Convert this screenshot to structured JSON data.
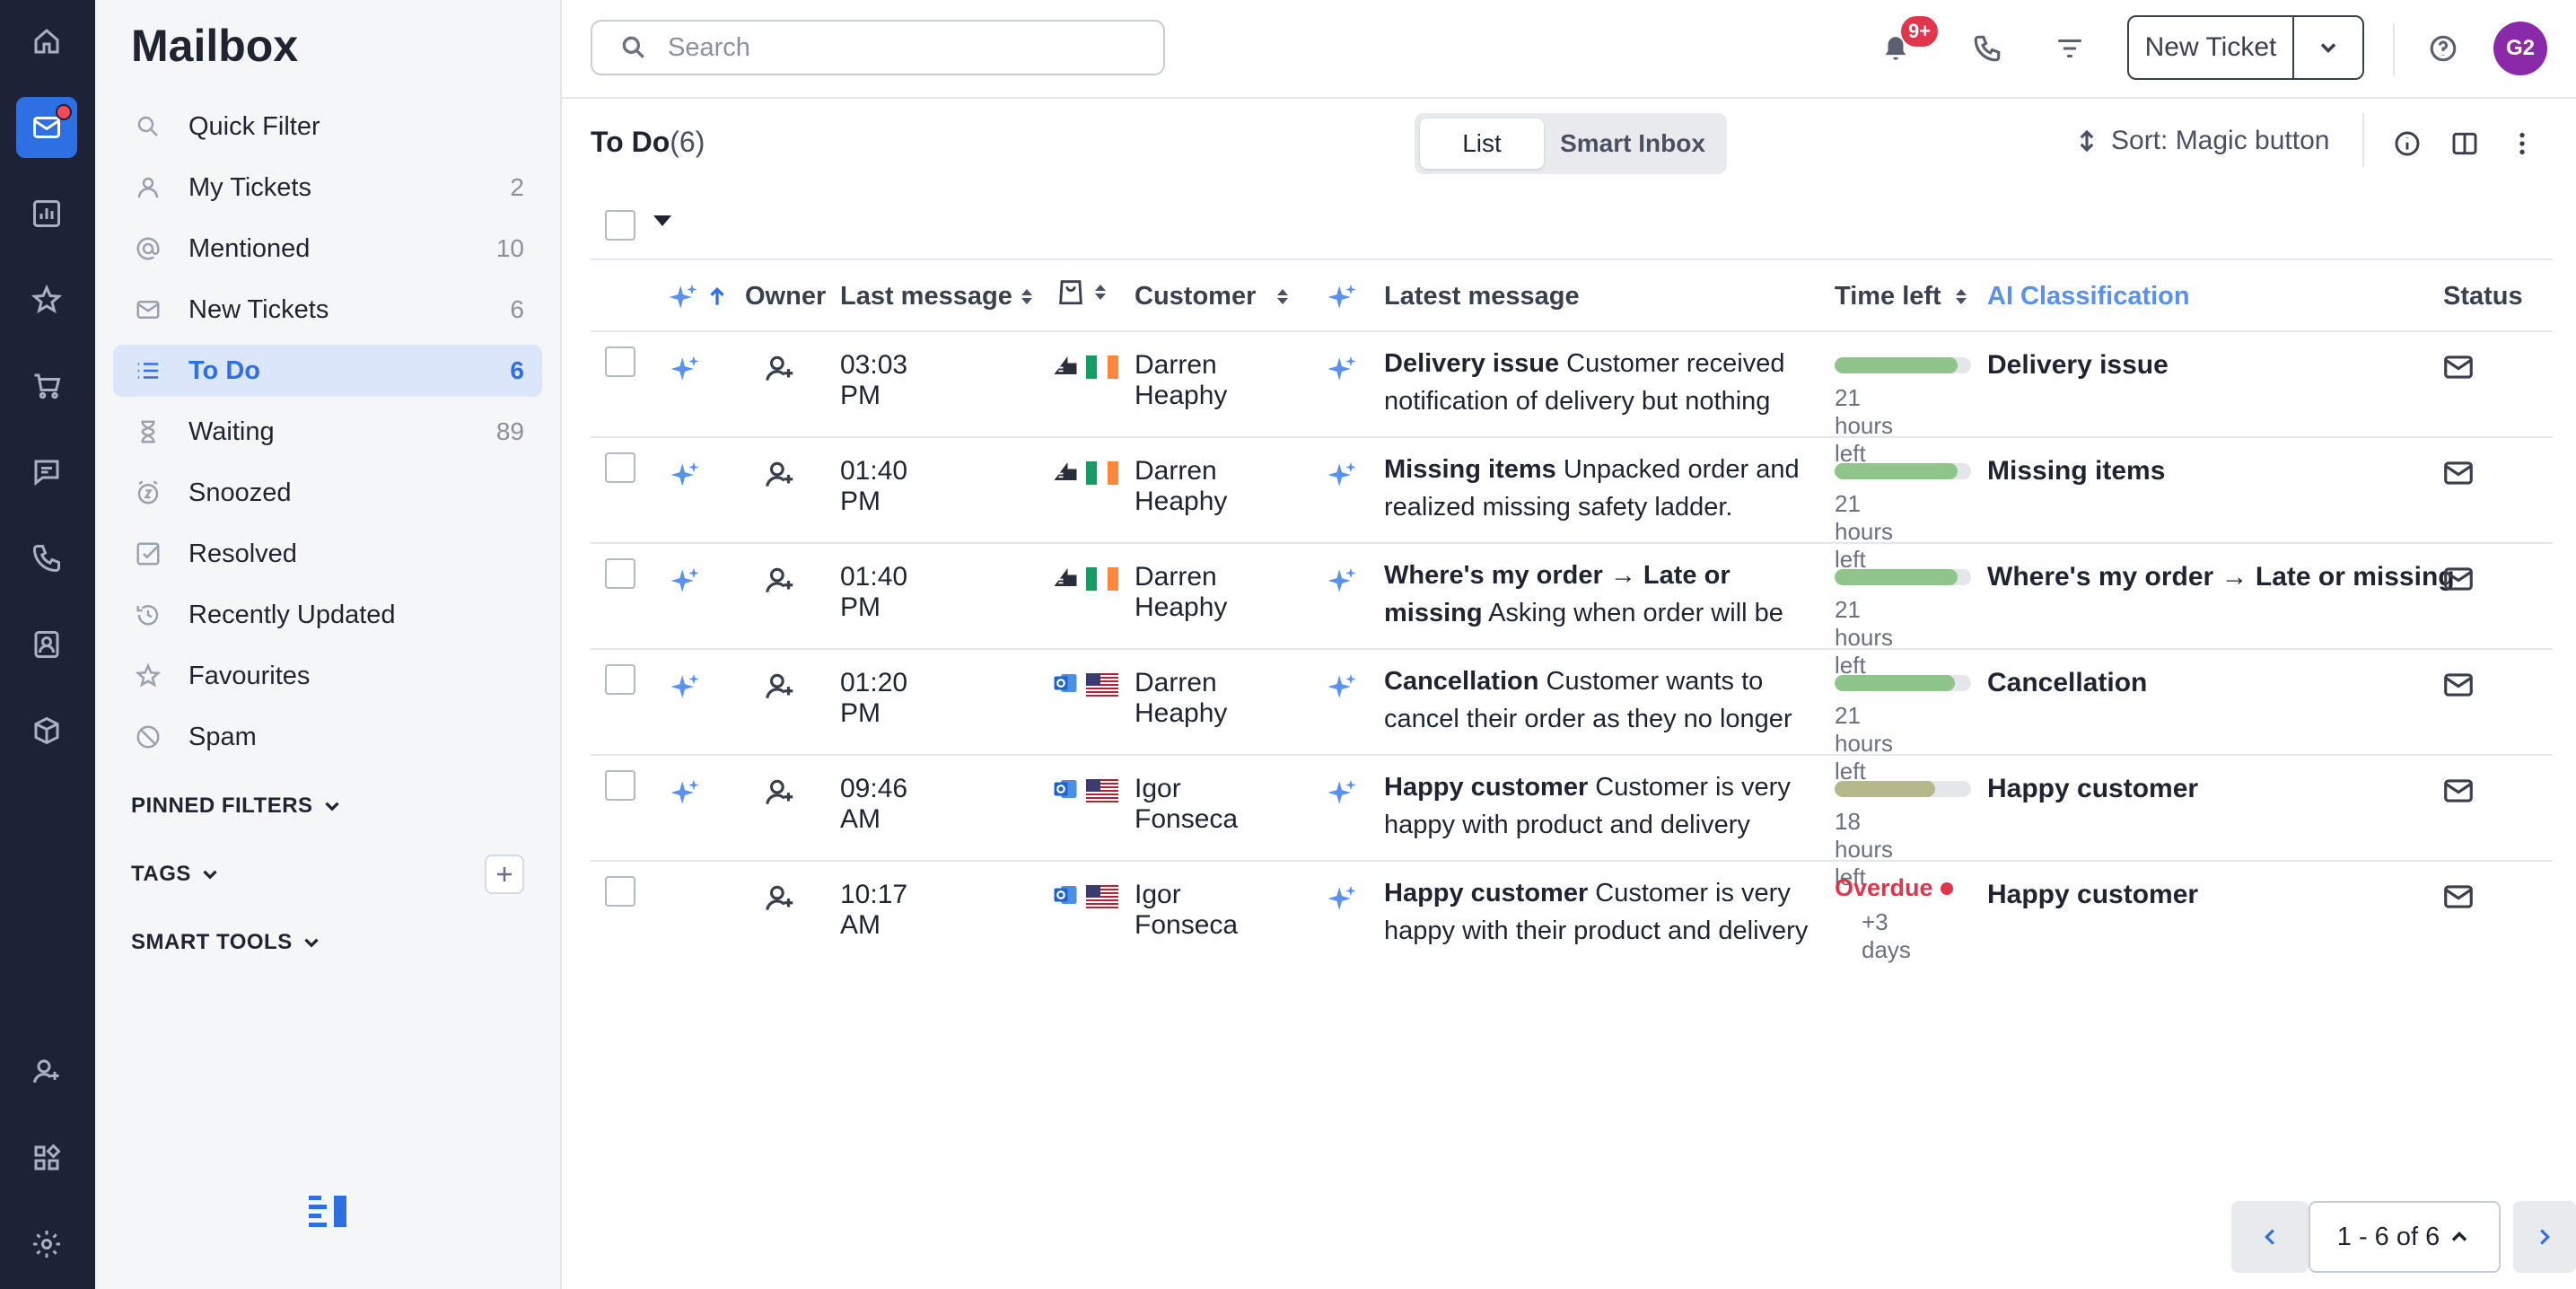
{
  "app": {
    "title": "Mailbox"
  },
  "rail": {
    "items": [
      {
        "name": "home-icon"
      },
      {
        "name": "mail-icon",
        "active": true,
        "has_dot": true
      },
      {
        "name": "reports-icon"
      },
      {
        "name": "star-icon"
      },
      {
        "name": "cart-icon"
      },
      {
        "name": "chat-icon"
      },
      {
        "name": "phone-icon"
      },
      {
        "name": "contacts-icon"
      },
      {
        "name": "knowledge-icon"
      },
      {
        "name": "add-user-icon"
      },
      {
        "name": "apps-icon"
      },
      {
        "name": "settings-icon"
      }
    ]
  },
  "sidebar": {
    "items": [
      {
        "label": "Quick Filter",
        "count": "",
        "icon": "search-icon"
      },
      {
        "label": "My Tickets",
        "count": "2",
        "icon": "person-icon"
      },
      {
        "label": "Mentioned",
        "count": "10",
        "icon": "at-icon"
      },
      {
        "label": "New Tickets",
        "count": "6",
        "icon": "envelope-icon"
      },
      {
        "label": "To Do",
        "count": "6",
        "icon": "list-icon",
        "active": true
      },
      {
        "label": "Waiting",
        "count": "89",
        "icon": "hourglass-icon"
      },
      {
        "label": "Snoozed",
        "count": "",
        "icon": "snooze-icon"
      },
      {
        "label": "Resolved",
        "count": "",
        "icon": "check-icon"
      },
      {
        "label": "Recently Updated",
        "count": "",
        "icon": "history-icon"
      },
      {
        "label": "Favourites",
        "count": "",
        "icon": "star-icon"
      },
      {
        "label": "Spam",
        "count": "",
        "icon": "block-icon"
      }
    ],
    "sections": {
      "pinned": "PINNED FILTERS",
      "tags": "TAGS",
      "smart_tools": "SMART TOOLS"
    }
  },
  "topbar": {
    "search_placeholder": "Search",
    "notification_badge": "9+",
    "new_ticket_label": "New Ticket",
    "avatar_initials": "G2"
  },
  "view": {
    "title": "To Do",
    "count": "(6)",
    "segments": {
      "list": "List",
      "smart_inbox": "Smart Inbox"
    },
    "sort_label": "Sort: Magic button"
  },
  "table": {
    "headers": {
      "owner": "Owner",
      "last_message": "Last message",
      "customer": "Customer",
      "latest_message": "Latest message",
      "time_left": "Time left",
      "ai_classification": "AI Classification",
      "status": "Status"
    },
    "rows": [
      {
        "time": "03:03 PM",
        "channel": "marketplace",
        "flag": "ie",
        "customer": "Darren Heaphy",
        "subject": "Delivery issue",
        "body": "Customer received notification of delivery but nothing",
        "time_left_fraction": 0.9,
        "time_left_color": "#8fc48a",
        "time_left": "21 hours left",
        "overdue": false,
        "ai": "Delivery issue",
        "has_sparkle": true
      },
      {
        "time": "01:40 PM",
        "channel": "marketplace",
        "flag": "ie",
        "customer": "Darren Heaphy",
        "subject": "Missing items",
        "body": "Unpacked order and realized missing safety ladder.",
        "time_left_fraction": 0.9,
        "time_left_color": "#8fc48a",
        "time_left": "21 hours left",
        "overdue": false,
        "ai": "Missing items",
        "has_sparkle": true
      },
      {
        "time": "01:40 PM",
        "channel": "marketplace",
        "flag": "ie",
        "customer": "Darren Heaphy",
        "subject": "Where's my order → Late or missing",
        "body": "Asking when order will be",
        "time_left_fraction": 0.9,
        "time_left_color": "#8fc48a",
        "time_left": "21 hours left",
        "overdue": false,
        "ai": "Where's my order → Late or missing",
        "has_sparkle": true
      },
      {
        "time": "01:20 PM",
        "channel": "outlook",
        "flag": "us",
        "customer": "Darren Heaphy",
        "subject": "Cancellation",
        "body": "Customer wants to cancel their order as they no longer",
        "time_left_fraction": 0.88,
        "time_left_color": "#8fc48a",
        "time_left": "21 hours left",
        "overdue": false,
        "ai": "Cancellation",
        "has_sparkle": true
      },
      {
        "time": "09:46 AM",
        "channel": "outlook",
        "flag": "us",
        "customer": "Igor Fonseca",
        "subject": "Happy customer",
        "body": "Customer is very happy with product and delivery",
        "time_left_fraction": 0.74,
        "time_left_color": "#b5b98a",
        "time_left": "18 hours left",
        "overdue": false,
        "ai": "Happy customer",
        "has_sparkle": true
      },
      {
        "time": "10:17 AM",
        "channel": "outlook",
        "flag": "us",
        "customer": "Igor Fonseca",
        "subject": "Happy customer",
        "body": "Customer is very happy with their product and delivery",
        "time_left_fraction": 0,
        "time_left_color": "#e0354b",
        "time_left": "+3 days",
        "overdue": true,
        "overdue_label": "Overdue",
        "ai": "Happy customer",
        "has_sparkle": false
      }
    ]
  },
  "pagination": {
    "info": "1 - 6 of 6"
  },
  "colors": {
    "accent": "#2f6fe4",
    "rail": "#1e2236",
    "overdue": "#e0354b",
    "ai_header": "#5a90ee"
  }
}
